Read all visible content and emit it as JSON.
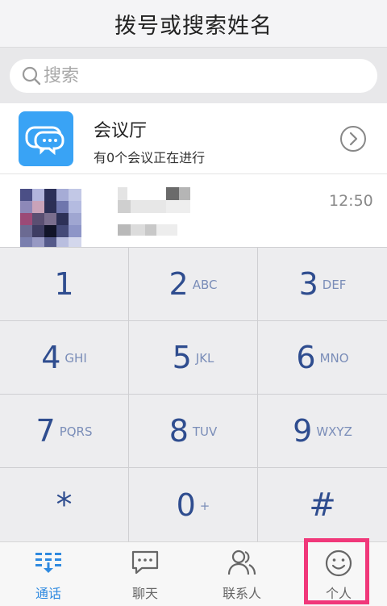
{
  "header": {
    "title": "拨号或搜索姓名"
  },
  "search": {
    "placeholder": "搜索"
  },
  "meeting": {
    "name": "会议厅",
    "subtitle": "有0个会议正在进行"
  },
  "recent": {
    "time": "12:50"
  },
  "keypad": {
    "keys": [
      {
        "digit": "1",
        "letters": ""
      },
      {
        "digit": "2",
        "letters": "ABC"
      },
      {
        "digit": "3",
        "letters": "DEF"
      },
      {
        "digit": "4",
        "letters": "GHI"
      },
      {
        "digit": "5",
        "letters": "JKL"
      },
      {
        "digit": "6",
        "letters": "MNO"
      },
      {
        "digit": "7",
        "letters": "PQRS"
      },
      {
        "digit": "8",
        "letters": "TUV"
      },
      {
        "digit": "9",
        "letters": "WXYZ"
      },
      {
        "digit": "*",
        "letters": ""
      },
      {
        "digit": "0",
        "letters": "+"
      },
      {
        "digit": "#",
        "letters": ""
      }
    ]
  },
  "tabbar": {
    "tabs": [
      {
        "label": "通话",
        "icon": "dialpad-icon",
        "active": true
      },
      {
        "label": "聊天",
        "icon": "chat-bubble-icon",
        "active": false
      },
      {
        "label": "联系人",
        "icon": "contacts-icon",
        "active": false
      },
      {
        "label": "个人",
        "icon": "smiley-icon",
        "active": false
      }
    ]
  },
  "colors": {
    "accent": "#2f8ae0",
    "digit": "#2f4d8f",
    "highlight": "#f0387a",
    "meeting_icon": "#39a3f5"
  }
}
